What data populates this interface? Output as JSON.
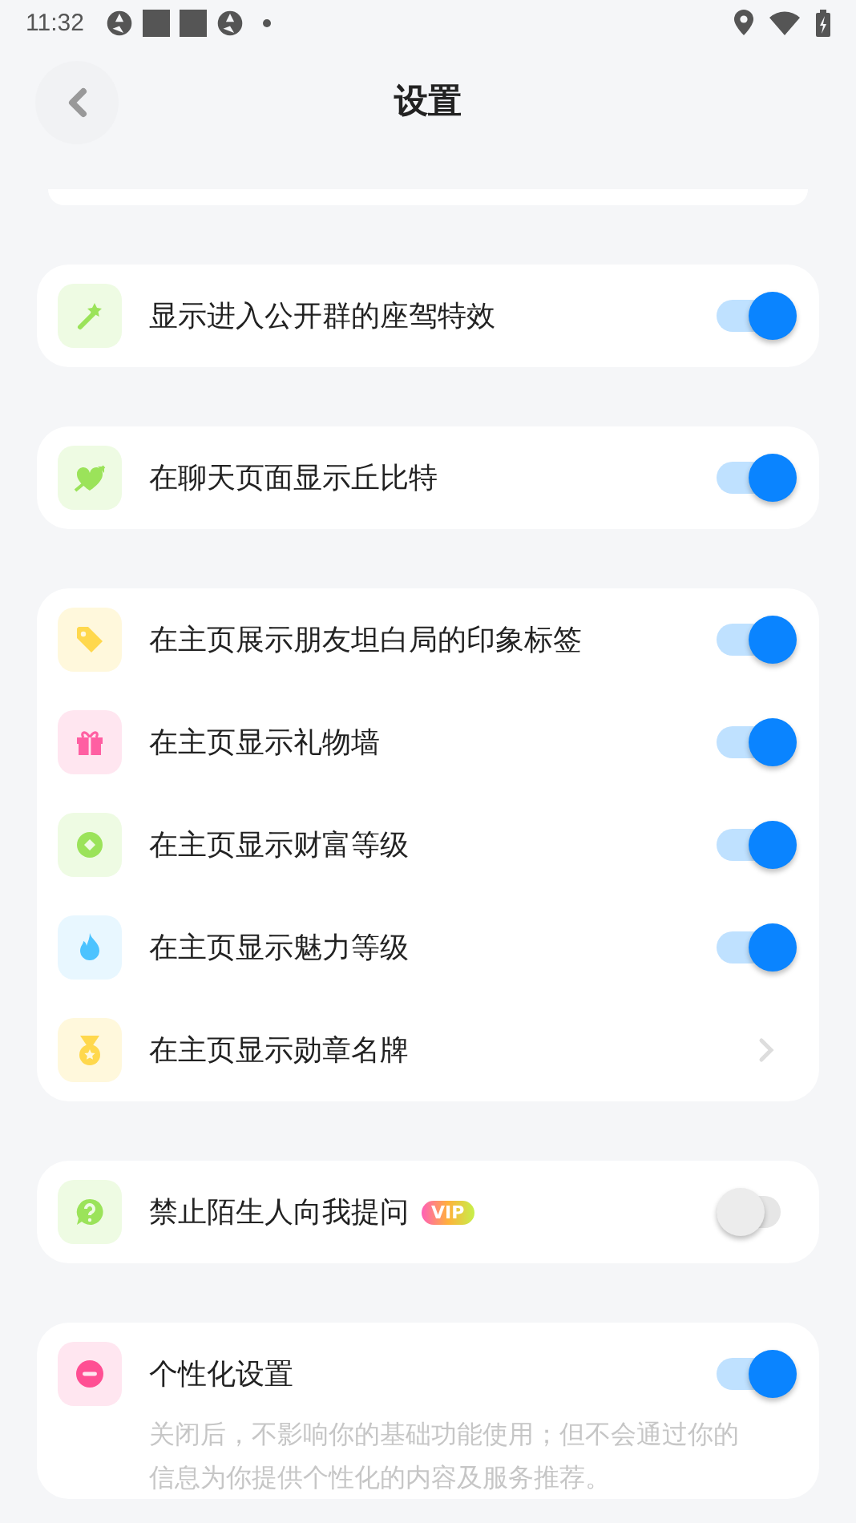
{
  "status_bar": {
    "time": "11:32"
  },
  "header": {
    "title": "设置"
  },
  "groups": [
    {
      "rows": [
        {
          "kind": "toggle",
          "label": "显示进入公开群的座驾特效",
          "on": true
        }
      ]
    },
    {
      "rows": [
        {
          "kind": "toggle",
          "label": "在聊天页面显示丘比特",
          "on": true
        }
      ]
    },
    {
      "rows": [
        {
          "kind": "toggle",
          "label": "在主页展示朋友坦白局的印象标签",
          "on": true
        },
        {
          "kind": "toggle",
          "label": "在主页显示礼物墙",
          "on": true
        },
        {
          "kind": "toggle",
          "label": "在主页显示财富等级",
          "on": true
        },
        {
          "kind": "toggle",
          "label": "在主页显示魅力等级",
          "on": true
        },
        {
          "kind": "arrow",
          "label": "在主页显示勋章名牌"
        }
      ]
    },
    {
      "rows": [
        {
          "kind": "toggle",
          "label": "禁止陌生人向我提问",
          "badge": "VIP",
          "on": false
        }
      ]
    },
    {
      "rows": [
        {
          "kind": "toggle",
          "label": "个性化设置",
          "on": true,
          "description": "关闭后，不影响你的基础功能使用；但不会通过你的信息为你提供个性化的内容及服务推荐。"
        }
      ]
    }
  ]
}
